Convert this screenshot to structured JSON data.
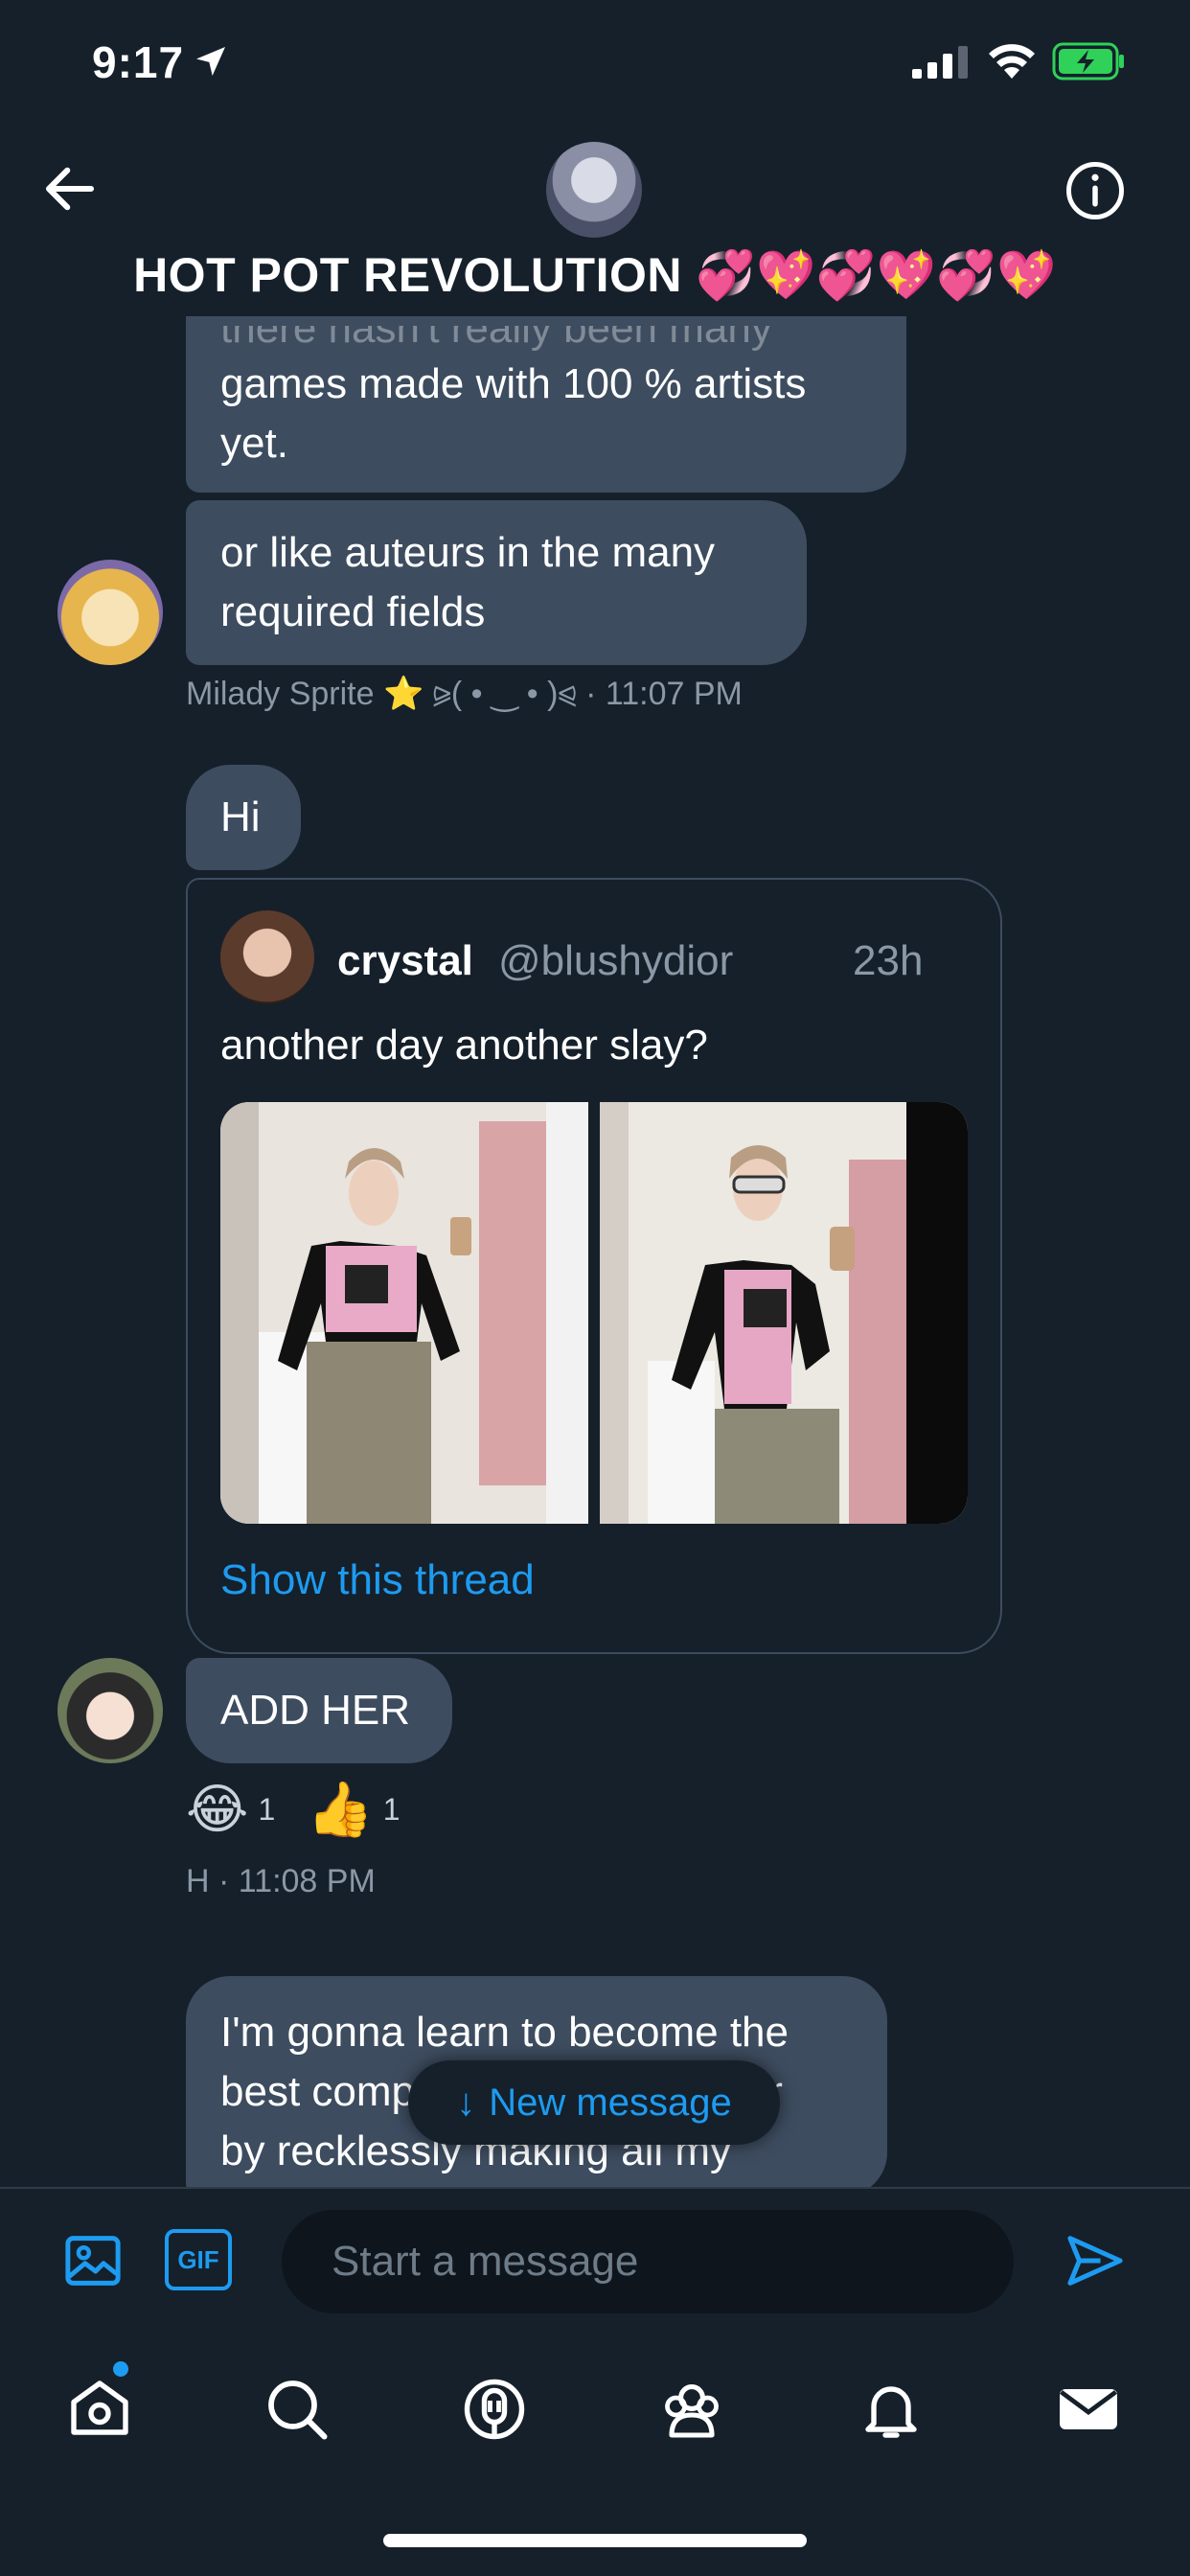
{
  "status_bar": {
    "time": "9:17"
  },
  "header": {
    "title": "HOT POT REVOLUTION 💞💖💞💖💞💖"
  },
  "messages": {
    "m1_lines": [
      "there hasn't really been many",
      "games made with 100 % artists",
      "yet."
    ],
    "m2_lines": [
      "or like auteurs in the many",
      "required fields"
    ],
    "m2_meta": "Milady Sprite ⭐ ⪩( • ‿ • )⪨ · 11:07 PM",
    "hi": "Hi",
    "quoted_tweet": {
      "name": "crystal",
      "handle": "@blushydior",
      "time": "23h",
      "text": "another day another slay?",
      "show_thread": "Show this thread"
    },
    "add_her": "ADD HER",
    "reactions": [
      {
        "emoji": "😂",
        "count": "1"
      },
      {
        "emoji": "👍",
        "count": "1"
      }
    ],
    "add_her_meta": "H · 11:08 PM",
    "last_lines": [
      "I'm gonna learn to become the",
      "best composer of all time ever",
      "by recklessly making all my"
    ]
  },
  "new_message_pill": {
    "arrow": "↓",
    "label": "New message"
  },
  "composer": {
    "gif_label": "GIF",
    "placeholder": "Start a message"
  },
  "colors": {
    "background": "#15202b",
    "bubble": "#3d4c5f",
    "accent": "#1d9bf0",
    "muted": "#8b98a5"
  },
  "tabs": [
    "home-icon",
    "search-icon",
    "spaces-icon",
    "communities-icon",
    "notifications-icon",
    "messages-icon"
  ]
}
